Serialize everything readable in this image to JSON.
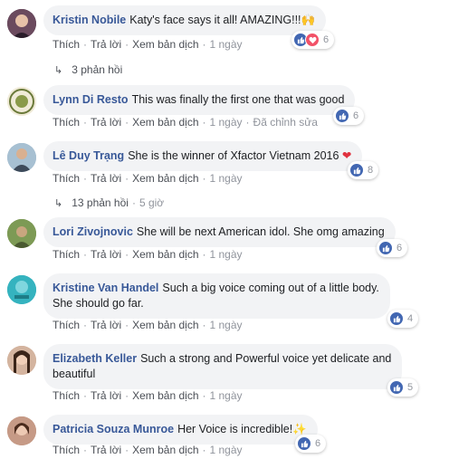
{
  "labels": {
    "like": "Thích",
    "reply": "Trả lời",
    "translate": "Xem bản dịch",
    "edited": "Đã chỉnh sửa",
    "dot": "·"
  },
  "comments": [
    {
      "name": "Kristin Nobile",
      "text": "Katy's face says it all! AMAZING!!!",
      "emoji": "🙌",
      "time": "1 ngày",
      "reactions": "6"
    },
    {
      "name": "Lynn Di Resto",
      "text": "This was finally the first one that was good",
      "time": "1 ngày",
      "reactions": "6"
    },
    {
      "name": "Lê Duy Trạng",
      "text": "She is the winner of Xfactor Vietnam 2016",
      "emoji": "❤",
      "time": "1 ngày",
      "reactions": "8"
    },
    {
      "name": "Lori Zivojnovic",
      "text": "She will be next American idol. She omg amazing",
      "time": "1 ngày",
      "reactions": "6"
    },
    {
      "name": "Kristine Van Handel",
      "text": "Such a big voice coming out of a little body.",
      "text2": "She should go far.",
      "time": "1 ngày",
      "reactions": "4"
    },
    {
      "name": "Elizabeth Keller",
      "text": "Such a strong and Powerful voice yet delicate and",
      "text2": "beautiful",
      "time": "1 ngày",
      "reactions": "5"
    },
    {
      "name": "Patricia Souza Munroe",
      "text": "Her Voice is incredible!",
      "emoji": "✨",
      "time": "1 ngày",
      "reactions": "6"
    }
  ],
  "reply_threads": [
    {
      "label": "3 phản hồi"
    },
    {
      "label": "13 phản hồi",
      "time": "5 giờ"
    }
  ],
  "colors": {
    "name": "#385898",
    "bubble": "#f2f3f5",
    "like": "#4267b2",
    "love": "#f25268",
    "wow": "#f7b125"
  }
}
